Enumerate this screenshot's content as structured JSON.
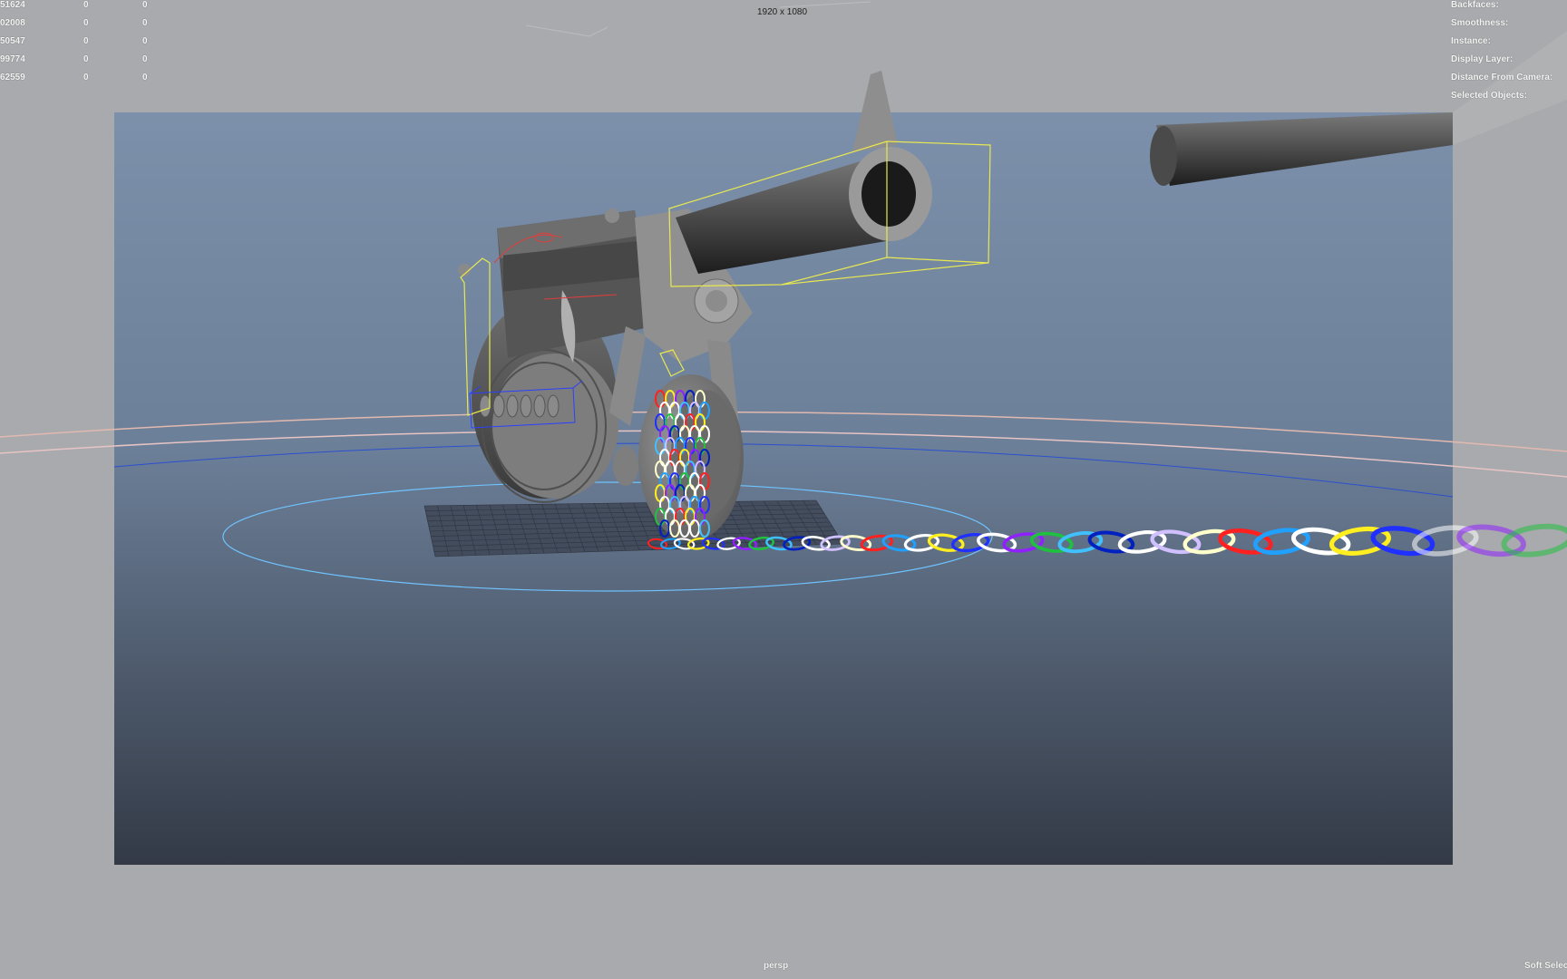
{
  "app": "Maya viewport",
  "viewport": {
    "resolution_gate": "1920 x 1080",
    "camera": "persp",
    "corner_tool_label": "Soft Selec"
  },
  "hud_left": {
    "rows": [
      [
        "51624",
        "0",
        "0"
      ],
      [
        "02008",
        "0",
        "0"
      ],
      [
        "50547",
        "0",
        "0"
      ],
      [
        "99774",
        "0",
        "0"
      ],
      [
        "62559",
        "0",
        "0"
      ]
    ]
  },
  "hud_right": {
    "labels": [
      "Backfaces:",
      "Smoothness:",
      "Instance:",
      "Display Layer:",
      "Distance From Camera:",
      "Selected Objects:"
    ]
  },
  "colors": {
    "background": "#a8aaad",
    "gate_top": "#7d91ab",
    "gate_bottom": "#343b47",
    "bbox_yellow": "#e8e850",
    "grid_blue": "#64b8ff"
  },
  "chain_link_colors": [
    "#ff2020",
    "#20a0ff",
    "#ffffff",
    "#ffee20",
    "#2030ff",
    "#ffffff",
    "#9020ff",
    "#20c040",
    "#40c0ff",
    "#0020c0",
    "#ffffff",
    "#d0c0ff",
    "#ffffcc"
  ]
}
